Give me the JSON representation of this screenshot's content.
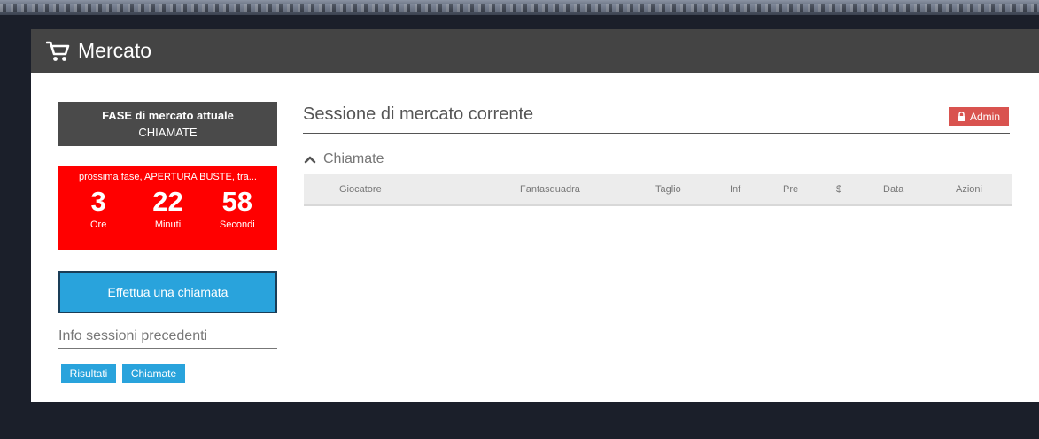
{
  "header": {
    "title": "Mercato",
    "icon": "cart-icon"
  },
  "phase": {
    "label": "FASE di mercato attuale",
    "value": "CHIAMATE"
  },
  "countdown": {
    "next_phase": "prossima fase, APERTURA BUSTE, tra...",
    "hours": "3",
    "hours_label": "Ore",
    "minutes": "22",
    "minutes_label": "Minuti",
    "seconds": "58",
    "seconds_label": "Secondi"
  },
  "actions": {
    "call_button": "Effettua una chiamata"
  },
  "previous": {
    "title": "Info sessioni precedenti",
    "results_button": "Risultati",
    "calls_button": "Chiamate"
  },
  "session": {
    "title": "Sessione di mercato corrente",
    "admin_label": "Admin",
    "calls_section": "Chiamate",
    "columns": [
      "Giocatore",
      "Fantasquadra",
      "Taglio",
      "Inf",
      "Pre",
      "$",
      "Data",
      "Azioni"
    ]
  },
  "colors": {
    "accent": "#29a3dc",
    "countdown": "#ff0000",
    "admin": "#d9534f",
    "header": "#444444"
  }
}
